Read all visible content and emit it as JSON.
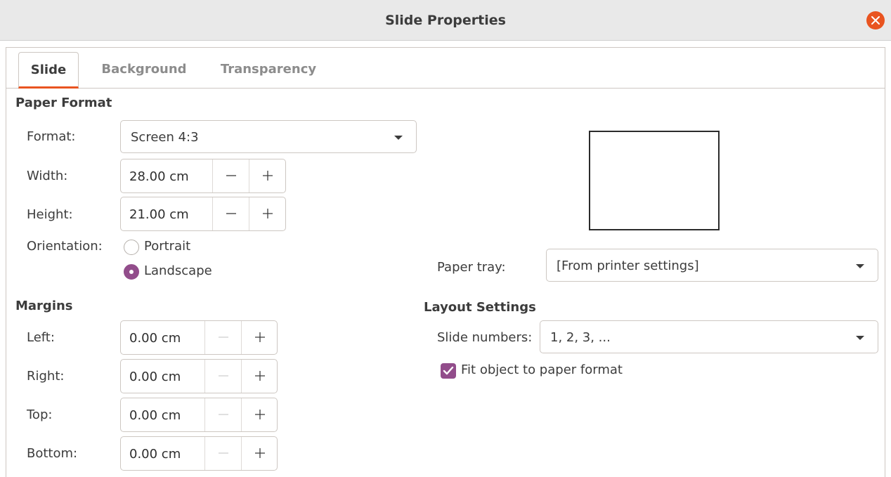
{
  "window": {
    "title": "Slide Properties"
  },
  "tabs": [
    {
      "label": "Slide",
      "active": true
    },
    {
      "label": "Background",
      "active": false
    },
    {
      "label": "Transparency",
      "active": false
    }
  ],
  "paper_format": {
    "heading": "Paper Format",
    "format_label": "Format:",
    "format_value": "Screen 4:3",
    "width_label": "Width:",
    "width_value": "28.00 cm",
    "height_label": "Height:",
    "height_value": "21.00 cm",
    "orientation_label": "Orientation:",
    "orientation_options": [
      {
        "label": "Portrait",
        "checked": false
      },
      {
        "label": "Landscape",
        "checked": true
      }
    ]
  },
  "margins": {
    "heading": "Margins",
    "left_label": "Left:",
    "left_value": "0.00 cm",
    "right_label": "Right:",
    "right_value": "0.00 cm",
    "top_label": "Top:",
    "top_value": "0.00 cm",
    "bottom_label": "Bottom:",
    "bottom_value": "0.00 cm"
  },
  "paper_tray": {
    "label": "Paper tray:",
    "value": "[From printer settings]"
  },
  "layout_settings": {
    "heading": "Layout Settings",
    "slide_numbers_label": "Slide numbers:",
    "slide_numbers_value": "1, 2, 3, ...",
    "fit_object_label": "Fit object to paper format",
    "fit_object_checked": true
  },
  "colors": {
    "accent": "#924d8b",
    "close_button": "#e95420",
    "tab_underline": "#e95420"
  }
}
